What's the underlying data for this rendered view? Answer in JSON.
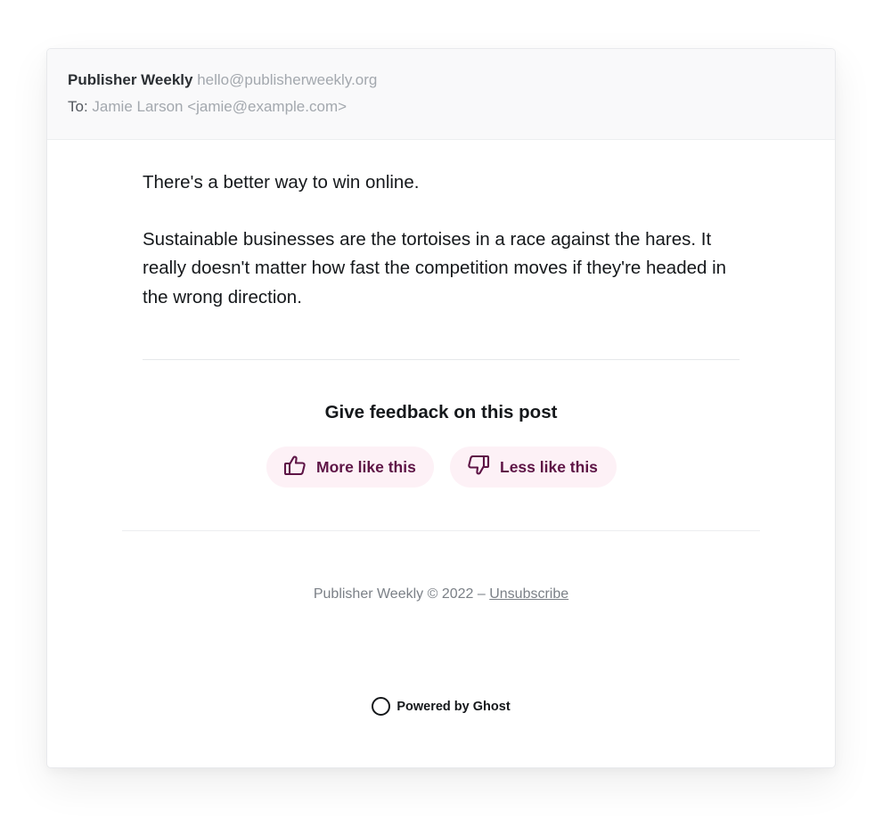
{
  "header": {
    "sender_name": "Publisher Weekly",
    "sender_email": "hello@publisherweekly.org",
    "to_prefix": "To:",
    "to_value": "Jamie Larson <jamie@example.com>"
  },
  "body": {
    "paragraphs": [
      "There's a better way to win online.",
      "Sustainable businesses are the tortoises in a race against the hares. It really doesn't matter how fast the competition moves if they're headed in the wrong direction."
    ]
  },
  "feedback": {
    "title": "Give feedback on this post",
    "more_label": "More like this",
    "less_label": "Less like this",
    "more_icon": "thumbs-up-icon",
    "less_icon": "thumbs-down-icon",
    "accent_color": "#5e1546",
    "button_bg": "#fdf1f6"
  },
  "footer": {
    "text": "Publisher Weekly © 2022 – ",
    "unsubscribe_label": "Unsubscribe"
  },
  "powered": {
    "label": "Powered by Ghost",
    "icon": "ghost-ring-icon"
  }
}
